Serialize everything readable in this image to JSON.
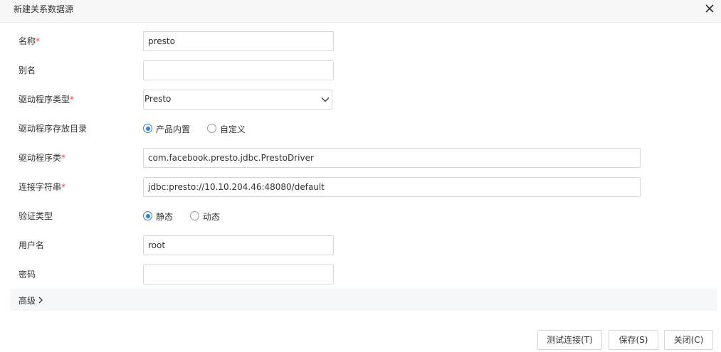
{
  "dialog": {
    "title": "新建关系数据源"
  },
  "form": {
    "name": {
      "label": "名称",
      "required": "*",
      "value": "presto"
    },
    "alias": {
      "label": "别名",
      "value": ""
    },
    "driver_type": {
      "label": "驱动程序类型",
      "required": "*",
      "value": "Presto"
    },
    "driver_dir": {
      "label": "驱动程序存放目录",
      "options": [
        {
          "label": "产品内置",
          "checked": true
        },
        {
          "label": "自定义",
          "checked": false
        }
      ]
    },
    "driver_class": {
      "label": "驱动程序类",
      "required": "*",
      "value": "com.facebook.presto.jdbc.PrestoDriver"
    },
    "connection_string": {
      "label": "连接字符串",
      "required": "*",
      "value": "jdbc:presto://10.10.204.46:48080/default"
    },
    "auth_type": {
      "label": "验证类型",
      "options": [
        {
          "label": "静态",
          "checked": true
        },
        {
          "label": "动态",
          "checked": false
        }
      ]
    },
    "username": {
      "label": "用户名",
      "value": "root"
    },
    "password": {
      "label": "密码",
      "value": ""
    }
  },
  "advanced": {
    "label": "高级"
  },
  "buttons": {
    "test": "测试连接(T)",
    "save": "保存(S)",
    "close": "关闭(C)"
  },
  "colors": {
    "accent": "#2e7cf6",
    "required": "#e0454b"
  }
}
